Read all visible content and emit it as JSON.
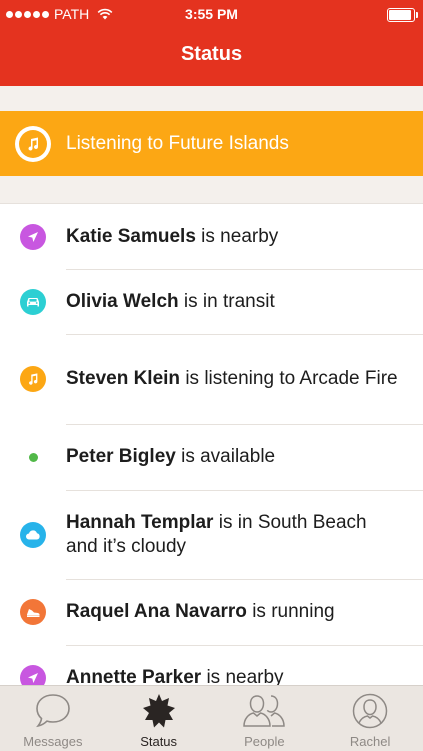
{
  "status_bar": {
    "carrier": "PATH",
    "time": "3:55 PM",
    "signal_dots": 5,
    "battery_level": 0.95
  },
  "header": {
    "title": "Status"
  },
  "now_playing": {
    "text": "Listening to Future Islands",
    "icon": "music-note-icon",
    "color": "#fca714"
  },
  "statuses": [
    {
      "name": "Katie Samuels",
      "status": " is nearby",
      "icon": "location-arrow-icon",
      "color": "#c857e0"
    },
    {
      "name": "Olivia Welch",
      "status": " is in transit",
      "icon": "car-icon",
      "color": "#2ccfd3"
    },
    {
      "name": "Steven Klein",
      "status": " is listening to Arcade Fire",
      "icon": "music-note-icon",
      "color": "#fca714"
    },
    {
      "name": "Peter Bigley",
      "status": " is available",
      "icon": "available-dot-icon",
      "color": "#51b848"
    },
    {
      "name": "Hannah Templar",
      "status": " is in South Beach and it’s cloudy",
      "icon": "cloud-icon",
      "color": "#27b3ea"
    },
    {
      "name": "Raquel Ana Navarro",
      "status": " is running",
      "icon": "running-shoe-icon",
      "color": "#f27638"
    },
    {
      "name": "Annette Parker",
      "status": " is nearby",
      "icon": "location-arrow-icon",
      "color": "#c857e0"
    }
  ],
  "tabs": [
    {
      "label": "Messages",
      "icon": "speech-bubble-icon"
    },
    {
      "label": "Status",
      "icon": "status-star-icon",
      "active": true
    },
    {
      "label": "People",
      "icon": "people-icon"
    },
    {
      "label": "Rachel",
      "icon": "profile-icon"
    }
  ],
  "colors": {
    "header": "#e4331f",
    "now_playing": "#fca714",
    "tab_bar": "#ebe6e1"
  }
}
